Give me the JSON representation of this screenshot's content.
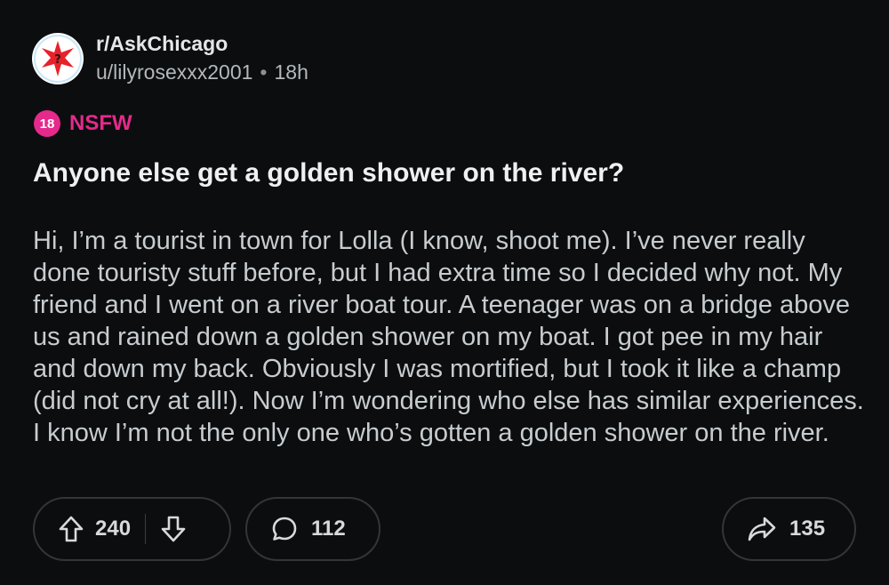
{
  "header": {
    "subreddit": "r/AskChicago",
    "user": "u/lilyrosexxx2001",
    "time": "18h",
    "separator": "•",
    "avatar_icon": "chicago-star-icon"
  },
  "nsfw": {
    "badge": "18",
    "label": "NSFW",
    "color": "#e52a8b"
  },
  "post": {
    "title": "Anyone else get a golden shower on the river?",
    "body": "Hi, I’m a tourist in town for Lolla (I know, shoot me). I’ve never really done touristy stuff before, but I had extra time so I decided why not. My friend and I went on a river boat tour. A teenager was on a bridge above us and rained down a golden shower on my boat. I got pee in my hair and down my back. Obviously I was mortified, but I took it like a champ (did not cry at all!). Now I’m wondering who else has similar experiences. I know I’m not the only one who’s gotten a golden shower on the river."
  },
  "actions": {
    "upvotes": "240",
    "comments": "112",
    "shares": "135"
  }
}
